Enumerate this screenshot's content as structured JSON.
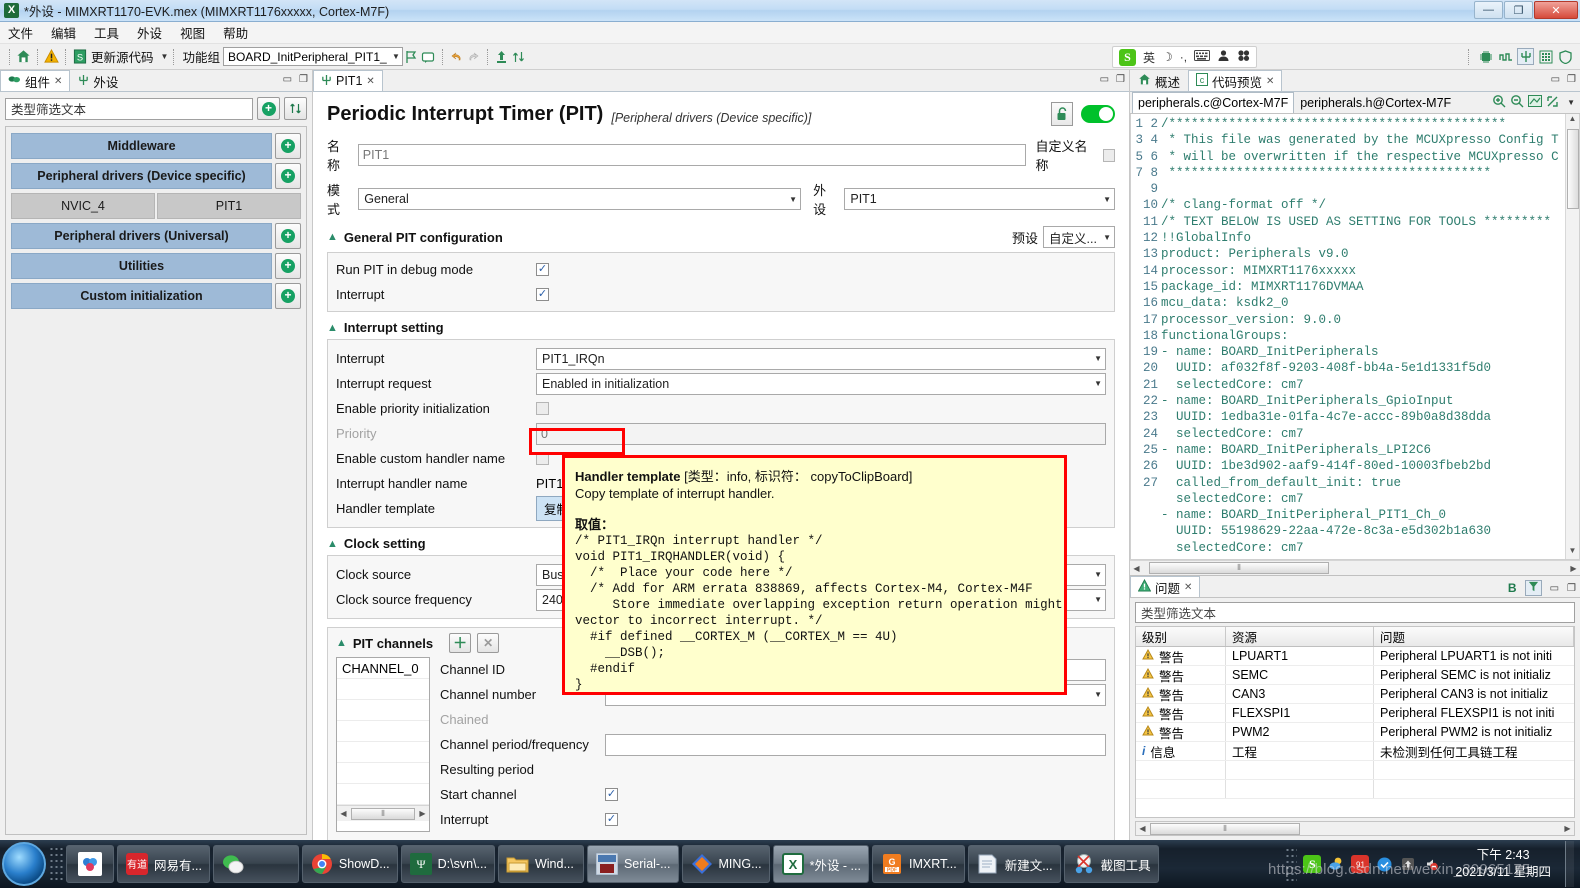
{
  "window": {
    "title": "*外设 - MIMXRT1170-EVK.mex (MIMXRT1176xxxxx, Cortex-M7F)",
    "app_icon": "X",
    "minimize": "—",
    "maximize": "❐",
    "close": "✕"
  },
  "menu": {
    "items": [
      "文件",
      "编辑",
      "工具",
      "外设",
      "视图",
      "帮助"
    ]
  },
  "toolbar": {
    "home_icon": "home-icon",
    "warning_icon": "warning-icon",
    "update_source_label": "更新源代码",
    "functional_group_label": "功能组",
    "functional_group_value": "BOARD_InitPeripheral_PIT1_",
    "flag_icon": "flag-icon",
    "note_icon": "note-icon",
    "undo_icon": "undo-icon",
    "redo_icon": "redo-icon",
    "export_icon": "export-icon",
    "sort_icon": "sort-icon",
    "ime": {
      "logo": "S",
      "mode": "英",
      "moon": "☽",
      "comma": "·,",
      "keyboard": "⌨",
      "user": "👤",
      "apps": "❖"
    },
    "right_icons": [
      "chip-icon",
      "pins-icon",
      "peripherals-icon",
      "clocks-icon",
      "security-icon"
    ]
  },
  "sidebar": {
    "tabs": [
      {
        "label": "组件",
        "icon": "components-icon",
        "active": true,
        "closable": true
      },
      {
        "label": "外设",
        "icon": "peripherals-icon",
        "active": false,
        "closable": false
      }
    ],
    "filter_placeholder": "类型筛选文本",
    "add_button_icon": "plus-circle-icon",
    "sort_button_icon": "sort-arrows-icon",
    "groups": [
      {
        "label": "Middleware",
        "children": []
      },
      {
        "label": "Peripheral drivers (Device specific)",
        "children": [
          "NVIC_4",
          "PIT1"
        ]
      },
      {
        "label": "Peripheral drivers (Universal)",
        "children": []
      },
      {
        "label": "Utilities",
        "children": []
      },
      {
        "label": "Custom initialization",
        "children": []
      }
    ]
  },
  "editor": {
    "tab_label": "PIT1",
    "tab_icon": "peripheral-icon",
    "title": "Periodic Interrupt Timer (PIT)",
    "subtitle": "[Peripheral drivers (Device specific)]",
    "lock_icon": "unlock-icon",
    "toggle_state": "on",
    "name_label": "名称",
    "name_value": "PIT1",
    "custom_name_label": "自定义名称",
    "mode_label": "模式",
    "mode_value": "General",
    "peripheral_label": "外设",
    "peripheral_value": "PIT1",
    "general_section": {
      "title": "General PIT configuration",
      "preset_label": "预设",
      "preset_value": "自定义...",
      "rows": [
        {
          "label": "Run PIT in debug mode",
          "checked": true
        },
        {
          "label": "Interrupt",
          "checked": true
        }
      ]
    },
    "interrupt_section": {
      "title": "Interrupt setting",
      "interrupt_label": "Interrupt",
      "interrupt_value": "PIT1_IRQn",
      "request_label": "Interrupt request",
      "request_value": "Enabled in initialization",
      "priority_init_label": "Enable priority initialization",
      "priority_init_checked": false,
      "priority_label": "Priority",
      "priority_value": "0",
      "custom_handler_label": "Enable custom handler name",
      "custom_handler_checked": false,
      "handler_name_label": "Interrupt handler name",
      "handler_name_value": "PIT1_IRQHANDLER",
      "handler_template_label": "Handler template",
      "handler_template_button": "复制到剪贴板"
    },
    "clock_section": {
      "title": "Clock setting",
      "source_label": "Clock source",
      "source_value": "Bus clock",
      "freq_label": "Clock source frequency",
      "freq_value": "240 MHz"
    },
    "channels_section": {
      "title": "PIT channels",
      "add_icon": "plus-icon",
      "remove_icon": "close-icon",
      "list_items": [
        "CHANNEL_0"
      ],
      "rows": [
        {
          "label": "Channel ID",
          "dim": false
        },
        {
          "label": "Channel number",
          "dim": false
        },
        {
          "label": "Chained",
          "dim": true
        },
        {
          "label": "Channel period/frequency",
          "dim": false
        },
        {
          "label": "Resulting period",
          "dim": false
        },
        {
          "label": "Start channel",
          "dim": false,
          "checked": true
        },
        {
          "label": "Interrupt",
          "dim": false,
          "checked": true
        }
      ]
    }
  },
  "tooltip": {
    "title": "Handler template",
    "meta": "[类型：info, 标识符： copyToClipBoard]",
    "description": "Copy template of interrupt handler.",
    "values_label": "取值：",
    "code": "/* PIT1_IRQn interrupt handler */\nvoid PIT1_IRQHANDLER(void) {\n  /*  Place your code here */\n  /* Add for ARM errata 838869, affects Cortex-M4, Cortex-M4F\n     Store immediate overlapping exception return operation might\nvector to incorrect interrupt. */\n  #if defined __CORTEX_M (__CORTEX_M == 4U)\n    __DSB();\n  #endif\n}"
  },
  "right_panel": {
    "tabs": [
      {
        "label": "概述",
        "icon": "overview-icon",
        "active": false
      },
      {
        "label": "代码预览",
        "icon": "code-preview-icon",
        "active": true
      }
    ],
    "code_tabs": [
      {
        "label": "peripherals.c@Cortex-M7F",
        "active": true
      },
      {
        "label": "peripherals.h@Cortex-M7F",
        "active": false
      }
    ],
    "code_tools": [
      "zoom-in-icon",
      "zoom-out-icon",
      "diff-icon",
      "compare-icon",
      "chevron-down-icon"
    ],
    "code_lines": [
      {
        "n": 1,
        "t": "/*********************************************"
      },
      {
        "n": 2,
        "t": " * This file was generated by the MCUXpresso Config T"
      },
      {
        "n": 3,
        "t": " * will be overwritten if the respective MCUXpresso C"
      },
      {
        "n": 4,
        "t": " *******************************************"
      },
      {
        "n": 5,
        "t": ""
      },
      {
        "n": 6,
        "t": "/* clang-format off */"
      },
      {
        "n": 7,
        "t": "/* TEXT BELOW IS USED AS SETTING FOR TOOLS *********"
      },
      {
        "n": 8,
        "t": "!!GlobalInfo"
      },
      {
        "n": 9,
        "t": "product: Peripherals v9.0"
      },
      {
        "n": 10,
        "t": "processor: MIMXRT1176xxxxx"
      },
      {
        "n": 11,
        "t": "package_id: MIMXRT1176DVMAA"
      },
      {
        "n": 12,
        "t": "mcu_data: ksdk2_0"
      },
      {
        "n": 13,
        "t": "processor_version: 9.0.0"
      },
      {
        "n": 14,
        "t": "functionalGroups:"
      },
      {
        "n": 15,
        "t": "- name: BOARD_InitPeripherals"
      },
      {
        "n": 16,
        "t": "  UUID: af032f8f-9203-408f-bb4a-5e1d1331f5d0"
      },
      {
        "n": 17,
        "t": "  selectedCore: cm7"
      },
      {
        "n": 18,
        "t": "- name: BOARD_InitPeripherals_GpioInput"
      },
      {
        "n": 19,
        "t": "  UUID: 1edba31e-01fa-4c7e-accc-89b0a8d38dda"
      },
      {
        "n": 20,
        "t": "  selectedCore: cm7"
      },
      {
        "n": 21,
        "t": "- name: BOARD_InitPeripherals_LPI2C6"
      },
      {
        "n": 22,
        "t": "  UUID: 1be3d902-aaf9-414f-80ed-10003fbeb2bd"
      },
      {
        "n": 23,
        "t": "  called_from_default_init: true"
      },
      {
        "n": 24,
        "t": "  selectedCore: cm7"
      },
      {
        "n": 25,
        "t": "- name: BOARD_InitPeripheral_PIT1_Ch_0"
      },
      {
        "n": 26,
        "t": "  UUID: 55198629-22aa-472e-8c3a-e5d302b1a630"
      },
      {
        "n": 27,
        "t": "  selectedCore: cm7"
      }
    ]
  },
  "problems": {
    "tab_label": "问题",
    "tab_icon": "problems-icon",
    "toolbar_icons": [
      "B",
      "filter-icon",
      "minimize-icon",
      "maximize-icon"
    ],
    "filter_placeholder": "类型筛选文本",
    "columns": [
      "级别",
      "资源",
      "问题"
    ],
    "rows": [
      {
        "level": "警告",
        "icon": "warning-icon",
        "resource": "LPUART1",
        "description": "Peripheral LPUART1 is not initi"
      },
      {
        "level": "警告",
        "icon": "warning-icon",
        "resource": "SEMC",
        "description": "Peripheral SEMC is not initializ"
      },
      {
        "level": "警告",
        "icon": "warning-icon",
        "resource": "CAN3",
        "description": "Peripheral CAN3 is not initializ"
      },
      {
        "level": "警告",
        "icon": "warning-icon",
        "resource": "FLEXSPI1",
        "description": "Peripheral FLEXSPI1 is not initi"
      },
      {
        "level": "警告",
        "icon": "warning-icon",
        "resource": "PWM2",
        "description": "Peripheral PWM2 is not initializ"
      },
      {
        "level": "信息",
        "icon": "info-icon",
        "resource": "工程",
        "description": "未检测到任何工具链工程"
      }
    ]
  },
  "taskbar": {
    "start_icon": "windows-orb-icon",
    "pinned": [
      {
        "icon": "cloud-icon",
        "label": "",
        "color": "#ffffff"
      }
    ],
    "items": [
      {
        "icon": "youdao-icon",
        "label": "网易有...",
        "active": false
      },
      {
        "icon": "wechat-icon",
        "label": "",
        "active": false
      },
      {
        "icon": "chrome-icon",
        "label": "ShowD...",
        "active": false
      },
      {
        "icon": "tortoise-icon",
        "label": "D:\\svn\\...",
        "active": false
      },
      {
        "icon": "folder-icon",
        "label": "Wind...",
        "active": false
      },
      {
        "icon": "serial-icon",
        "label": "Serial-...",
        "active": true
      },
      {
        "icon": "mingw-icon",
        "label": "MING...",
        "active": false
      },
      {
        "icon": "excel-icon",
        "label": "*外设 - ...",
        "active": true
      },
      {
        "icon": "pdf-icon",
        "label": "IMXRT...",
        "active": false
      },
      {
        "icon": "notepad-icon",
        "label": "新建文...",
        "active": false
      },
      {
        "icon": "snip-icon",
        "label": "截图工具",
        "active": false
      }
    ],
    "tray_icons": [
      "sogou-icon",
      "weather-icon",
      "red-icon",
      "shield-icon",
      "update-icon",
      "mute-icon"
    ],
    "clock_time": "下午 2:43",
    "clock_date": "2021/3/11 星期四",
    "watermark": "https://blog.csdn.net/weixin_30965175"
  }
}
